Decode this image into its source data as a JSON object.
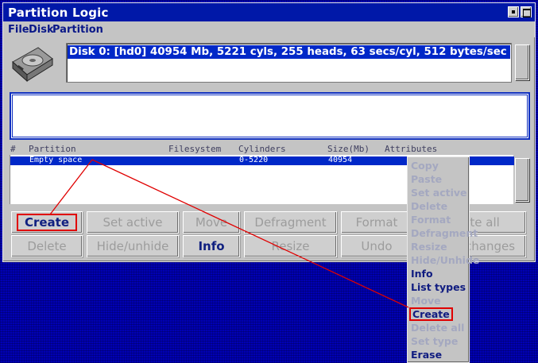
{
  "app_title": "Partition Logic",
  "menu": [
    "File",
    "Disk",
    "Partition"
  ],
  "disk_entry": "Disk 0: [hd0] 40954 Mb, 5221 cyls, 255 heads, 63 secs/cyl, 512 bytes/sec",
  "columns": {
    "num": "#",
    "partition": "Partition",
    "filesystem": "Filesystem",
    "cylinders": "Cylinders",
    "size": "Size(Mb)",
    "attributes": "Attributes"
  },
  "partition_row": {
    "partition": "Empty space",
    "filesystem": "",
    "cylinders": "0-5220",
    "size": "40954",
    "attributes": ""
  },
  "buttons_row1": {
    "create": "Create",
    "set_active": "Set active",
    "move": "Move",
    "defragment": "Defragment",
    "format": "Format",
    "delete_all": "Delete all"
  },
  "buttons_row2": {
    "delete": "Delete",
    "hide_unhide": "Hide/unhide",
    "info": "Info",
    "resize": "Resize",
    "undo": "Undo",
    "apply_changes": "Apply changes"
  },
  "context_menu": [
    {
      "label": "Copy",
      "enabled": false
    },
    {
      "label": "Paste",
      "enabled": false
    },
    {
      "label": "Set active",
      "enabled": false
    },
    {
      "label": "Delete",
      "enabled": false
    },
    {
      "label": "Format",
      "enabled": false
    },
    {
      "label": "Defragment",
      "enabled": false
    },
    {
      "label": "Resize",
      "enabled": false
    },
    {
      "label": "Hide/Unhide",
      "enabled": false
    },
    {
      "label": "Info",
      "enabled": true
    },
    {
      "label": "List types",
      "enabled": true
    },
    {
      "label": "Move",
      "enabled": false
    },
    {
      "label": "Create",
      "enabled": true
    },
    {
      "label": "Delete all",
      "enabled": false
    },
    {
      "label": "Set type",
      "enabled": false
    },
    {
      "label": "Erase",
      "enabled": true
    }
  ],
  "colors": {
    "desktop": "#0000b4",
    "titlebar": "#0018a8",
    "selection": "#0028c8",
    "highlight": "#e00000",
    "enabled_text": "#102080",
    "disabled_text": "#9c9c9c"
  }
}
